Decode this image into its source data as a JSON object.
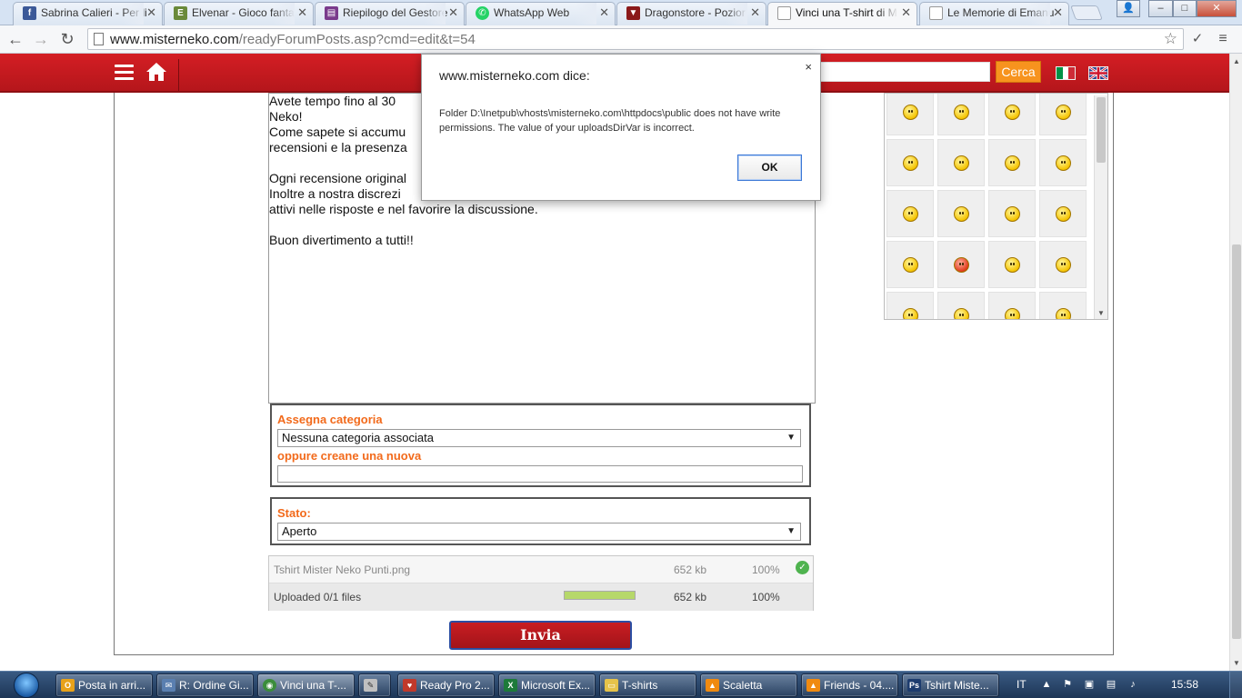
{
  "browser": {
    "tabs": [
      {
        "title": "Sabrina Calieri - Per li",
        "icon": "facebook-icon",
        "color": "#3b5998"
      },
      {
        "title": "Elvenar - Gioco fanta",
        "icon": "elvenar-icon",
        "color": "#6a8a3a"
      },
      {
        "title": "Riepilogo del Gestore",
        "icon": "store-icon",
        "color": "#7a3b8c"
      },
      {
        "title": "WhatsApp Web",
        "icon": "whatsapp-icon",
        "color": "#25d366"
      },
      {
        "title": "Dragonstore - Pozior",
        "icon": "dragonstore-icon",
        "color": "#8b1a1a"
      },
      {
        "title": "Vinci una T-shirt di M",
        "icon": "page-icon",
        "color": "#9aa4b2"
      },
      {
        "title": "Le Memorie di Emanu",
        "icon": "page-icon",
        "color": "#9aa4b2"
      }
    ],
    "url_host": "www.misterneko.com",
    "url_path": "/readyForumPosts.asp?cmd=edit&t=54",
    "window_controls": {
      "minimize": "–",
      "maximize": "□",
      "close": "✕"
    }
  },
  "site": {
    "search_button": "Cerca",
    "brand_color": "#c8191f"
  },
  "editor": {
    "lines": [
      "Avete tempo fino al 30",
      "Neko!",
      "Come sapete si accumu",
      "recensioni e la presenza",
      "",
      "Ogni recensione original",
      "Inoltre a nostra discrezi",
      "attivi nelle risposte e nel favorire la discussione.",
      "",
      "Buon divertimento a tutti!!"
    ]
  },
  "category": {
    "label": "Assegna categoria",
    "selected": "Nessuna categoria associata",
    "new_label": "oppure creane una nuova",
    "new_value": ""
  },
  "status": {
    "label": "Stato:",
    "selected": "Aperto"
  },
  "upload": {
    "file_name": "Tshirt Mister Neko Punti.png",
    "file_size": "652 kb",
    "file_percent": "100%",
    "summary": "Uploaded 0/1 files",
    "total_size": "652 kb",
    "total_percent": "100%",
    "progress": 1.0
  },
  "submit_label": "Invia",
  "dialog": {
    "title": "www.misterneko.com dice:",
    "message": "Folder D:\\Inetpub\\vhosts\\misterneko.com\\httpdocs\\public does not have write permissions. The value of your uploadsDirVar is incorrect.",
    "ok_label": "OK",
    "close_label": "×"
  },
  "taskbar": {
    "items": [
      {
        "label": "Posta in arri...",
        "icon": "outlook-icon",
        "color": "#e8a21a"
      },
      {
        "label": "R: Ordine Gi...",
        "icon": "mail-reply-icon",
        "color": "#5a7fb0"
      },
      {
        "label": "Vinci una T-...",
        "icon": "chrome-icon",
        "color": "#3b8d3b"
      },
      {
        "label": "",
        "icon": "paint-icon",
        "color": "#c0c0c0"
      },
      {
        "label": "Ready Pro 2...",
        "icon": "readypro-icon",
        "color": "#c0392b"
      },
      {
        "label": "Microsoft Ex...",
        "icon": "excel-icon",
        "color": "#1d7a3a"
      },
      {
        "label": "T-shirts",
        "icon": "folder-icon",
        "color": "#e6c34a"
      },
      {
        "label": "Scaletta",
        "icon": "vlc-icon",
        "color": "#f08a10"
      },
      {
        "label": "Friends - 04....",
        "icon": "vlc-icon",
        "color": "#f08a10"
      },
      {
        "label": "Tshirt Miste...",
        "icon": "photoshop-icon",
        "color": "#1d3c6e"
      }
    ],
    "language": "IT",
    "clock": "15:58"
  }
}
